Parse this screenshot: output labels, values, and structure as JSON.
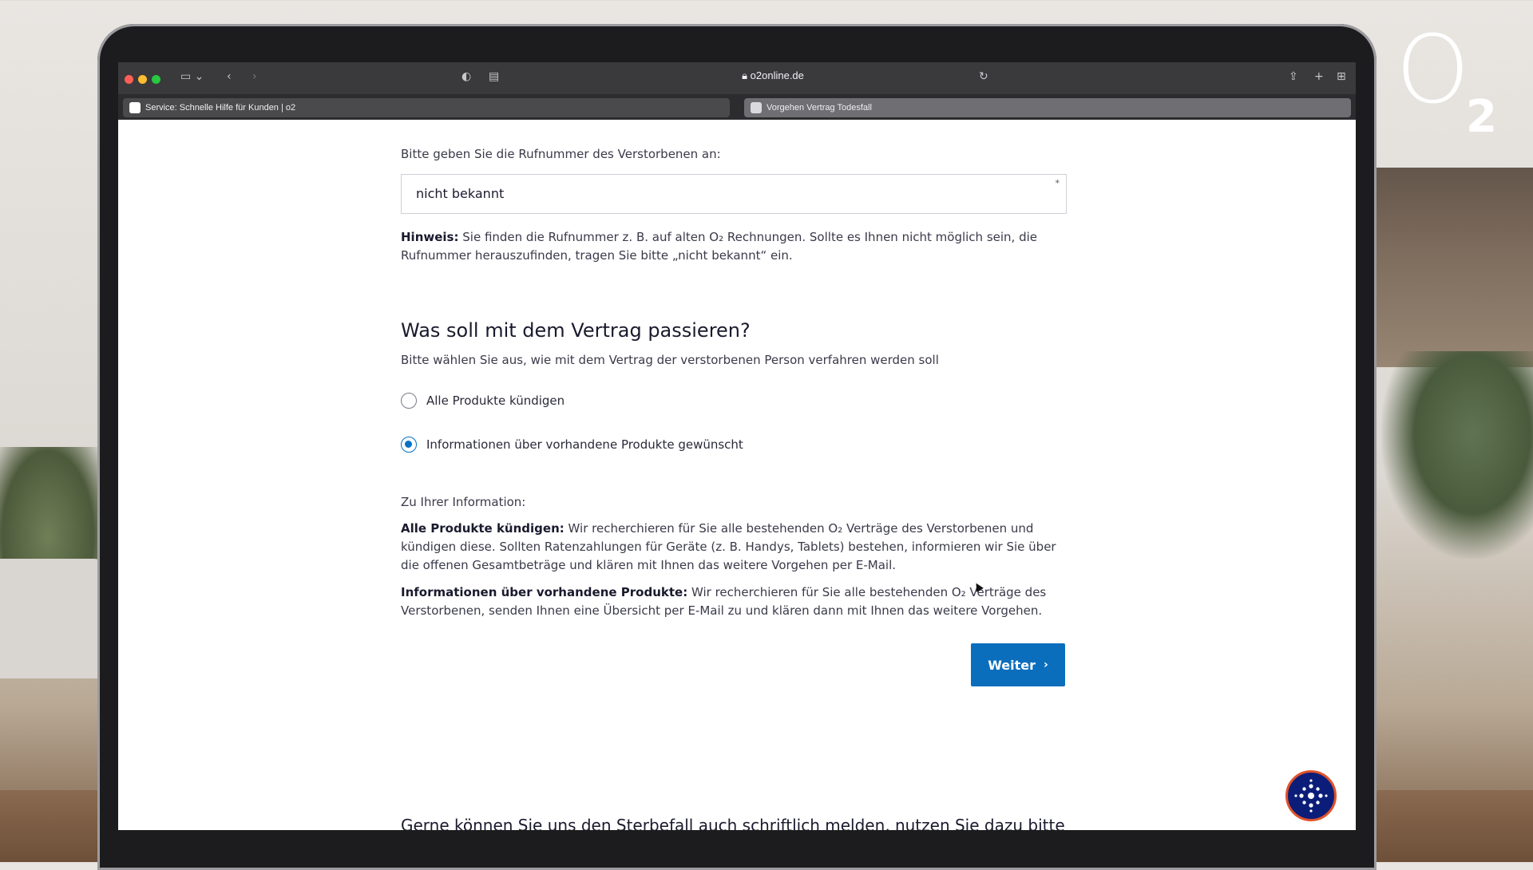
{
  "browser": {
    "url": "o2online.de",
    "tabs": [
      {
        "label": "Service: Schnelle Hilfe für Kunden | o2"
      },
      {
        "label": "Vorgehen Vertrag Todesfall"
      }
    ]
  },
  "brand": {
    "logo_text": "O",
    "logo_sub": "2",
    "accent_color": "#0a6ebd"
  },
  "form": {
    "phone_label": "Bitte geben Sie die Rufnummer des Verstorbenen an:",
    "phone_value": "nicht bekannt",
    "required_mark": "*",
    "hint_bold": "Hinweis:",
    "hint_text": "Sie finden die Rufnummer z. B. auf alten O₂ Rechnungen. Sollte es Ihnen nicht möglich sein, die Rufnummer herauszufinden, tragen Sie bitte „nicht bekannt“ ein.",
    "section_title": "Was soll mit dem Vertrag passieren?",
    "section_subtitle": "Bitte wählen Sie aus, wie mit dem Vertrag der verstorbenen Person verfahren werden soll",
    "options": [
      {
        "label": "Alle Produkte kündigen",
        "selected": false
      },
      {
        "label": "Informationen über vorhandene Produkte gewünscht",
        "selected": true
      }
    ],
    "info_heading": "Zu Ihrer Information:",
    "info_1_bold": "Alle Produkte kündigen:",
    "info_1_text": "Wir recherchieren für Sie alle bestehenden O₂ Verträge des Verstorbenen und kündigen diese. Sollten Ratenzahlungen für Geräte (z. B. Handys, Tablets) bestehen, informieren wir Sie über die offenen Gesamtbeträge und klären mit Ihnen das weitere Vorgehen per E-Mail.",
    "info_2_bold": "Informationen über vorhandene Produkte:",
    "info_2_text": "Wir recherchieren für Sie alle bestehenden O₂ Verträge des Verstorbenen, senden Ihnen eine Übersicht per E-Mail zu und klären dann mit Ihnen das weitere Vorgehen.",
    "submit_label": "Weiter",
    "footer_text": "Gerne können Sie uns den Sterbefall auch schriftlich melden, nutzen Sie dazu bitte"
  }
}
